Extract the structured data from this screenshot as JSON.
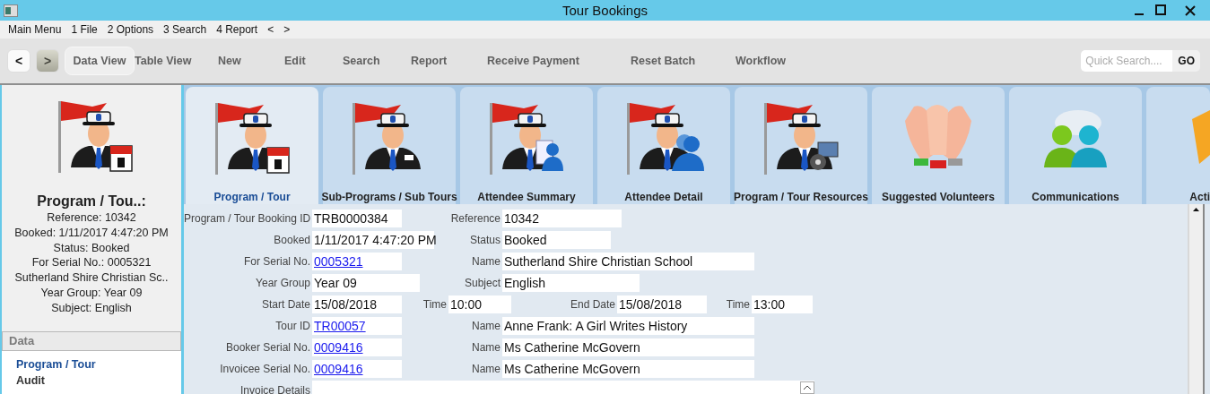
{
  "window": {
    "title": "Tour Bookings"
  },
  "menu_bar": [
    "Main Menu",
    "1 File",
    "2 Options",
    "3 Search",
    "4 Report",
    "<",
    ">"
  ],
  "nav_buttons": [
    {
      "label": "<",
      "disabled": false
    },
    {
      "label": ">",
      "disabled": true
    }
  ],
  "toolbar": [
    {
      "label": "Data View",
      "selected": true
    },
    {
      "label": "Table View",
      "selected": false
    },
    {
      "label": "New",
      "selected": false
    },
    {
      "label": "Edit",
      "selected": false
    },
    {
      "label": "Search",
      "selected": false
    },
    {
      "label": "Report",
      "selected": false
    },
    {
      "label": "Receive Payment",
      "selected": false
    },
    {
      "label": "Reset Batch",
      "selected": false
    },
    {
      "label": "Workflow",
      "selected": false
    }
  ],
  "quick_search": {
    "placeholder": "Quick Search....",
    "button": "GO"
  },
  "summary": {
    "title": "Program / Tou..:",
    "lines": [
      "Reference: 10342",
      "Booked: 1/11/2017 4:47:20 PM",
      "Status: Booked",
      "For Serial No.: 0005321",
      "Sutherland Shire Christian Sc..",
      "Year Group: Year 09",
      "Subject: English"
    ]
  },
  "side_nav": {
    "header": "Data",
    "items": [
      {
        "label": "Program / Tour",
        "selected": true
      },
      {
        "label": "Audit",
        "selected": false
      }
    ]
  },
  "tabs": [
    {
      "label": "Program / Tour",
      "selected": true
    },
    {
      "label": "Sub-Programs / Sub Tours",
      "selected": false
    },
    {
      "label": "Attendee Summary",
      "selected": false
    },
    {
      "label": "Attendee Detail",
      "selected": false
    },
    {
      "label": "Program / Tour Resources",
      "selected": false
    },
    {
      "label": "Suggested Volunteers",
      "selected": false
    },
    {
      "label": "Communications",
      "selected": false
    },
    {
      "label": "Acti",
      "selected": false
    }
  ],
  "form": {
    "rows": [
      {
        "fields": [
          {
            "label": "Program / Tour Booking ID",
            "value": "TRB0000384",
            "kind": "text"
          },
          {
            "label": "Reference",
            "value": "10342",
            "kind": "text"
          }
        ]
      },
      {
        "fields": [
          {
            "label": "Booked",
            "value": "1/11/2017 4:47:20 PM",
            "kind": "text"
          },
          {
            "label": "Status",
            "value": "Booked",
            "kind": "text"
          }
        ]
      },
      {
        "fields": [
          {
            "label": "For Serial No.",
            "value": "0005321",
            "kind": "link"
          },
          {
            "label": "Name",
            "value": "Sutherland Shire Christian School",
            "kind": "text"
          }
        ]
      },
      {
        "fields": [
          {
            "label": "Year Group",
            "value": "Year 09",
            "kind": "text"
          },
          {
            "label": "Subject",
            "value": "English",
            "kind": "text"
          }
        ]
      },
      {
        "fields": [
          {
            "label": "Start Date",
            "value": "15/08/2018",
            "kind": "text"
          },
          {
            "label": "Time",
            "value": "10:00",
            "kind": "text"
          },
          {
            "label": "End Date",
            "value": "15/08/2018",
            "kind": "text"
          },
          {
            "label": "Time",
            "value": "13:00",
            "kind": "text"
          }
        ]
      },
      {
        "fields": [
          {
            "label": "Tour ID",
            "value": "TR00057",
            "kind": "link"
          },
          {
            "label": "Name",
            "value": "Anne Frank: A Girl Writes History",
            "kind": "text"
          }
        ]
      },
      {
        "fields": [
          {
            "label": "Booker Serial No.",
            "value": "0009416",
            "kind": "link"
          },
          {
            "label": "Name",
            "value": "Ms Catherine McGovern",
            "kind": "text"
          }
        ]
      },
      {
        "fields": [
          {
            "label": "Invoicee Serial No.",
            "value": "0009416",
            "kind": "link"
          },
          {
            "label": "Name",
            "value": "Ms Catherine McGovern",
            "kind": "text"
          }
        ]
      },
      {
        "fields": [
          {
            "label": "Invoice Details",
            "kind": "textarea"
          }
        ]
      }
    ]
  }
}
